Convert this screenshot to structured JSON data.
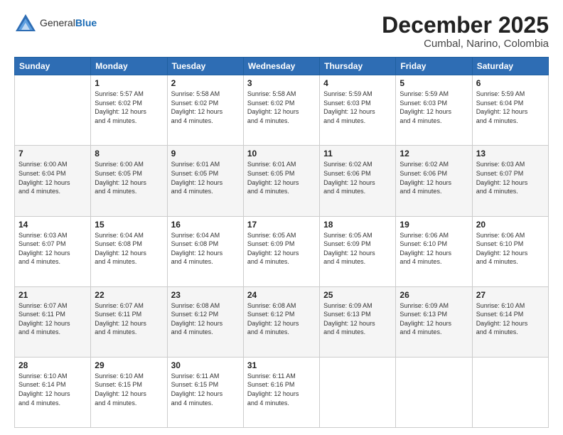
{
  "header": {
    "logo_general": "General",
    "logo_blue": "Blue",
    "month": "December 2025",
    "location": "Cumbal, Narino, Colombia"
  },
  "days_of_week": [
    "Sunday",
    "Monday",
    "Tuesday",
    "Wednesday",
    "Thursday",
    "Friday",
    "Saturday"
  ],
  "weeks": [
    [
      {
        "day": "",
        "info": ""
      },
      {
        "day": "1",
        "info": "Sunrise: 5:57 AM\nSunset: 6:02 PM\nDaylight: 12 hours\nand 4 minutes."
      },
      {
        "day": "2",
        "info": "Sunrise: 5:58 AM\nSunset: 6:02 PM\nDaylight: 12 hours\nand 4 minutes."
      },
      {
        "day": "3",
        "info": "Sunrise: 5:58 AM\nSunset: 6:02 PM\nDaylight: 12 hours\nand 4 minutes."
      },
      {
        "day": "4",
        "info": "Sunrise: 5:59 AM\nSunset: 6:03 PM\nDaylight: 12 hours\nand 4 minutes."
      },
      {
        "day": "5",
        "info": "Sunrise: 5:59 AM\nSunset: 6:03 PM\nDaylight: 12 hours\nand 4 minutes."
      },
      {
        "day": "6",
        "info": "Sunrise: 5:59 AM\nSunset: 6:04 PM\nDaylight: 12 hours\nand 4 minutes."
      }
    ],
    [
      {
        "day": "7",
        "info": "Sunrise: 6:00 AM\nSunset: 6:04 PM\nDaylight: 12 hours\nand 4 minutes."
      },
      {
        "day": "8",
        "info": "Sunrise: 6:00 AM\nSunset: 6:05 PM\nDaylight: 12 hours\nand 4 minutes."
      },
      {
        "day": "9",
        "info": "Sunrise: 6:01 AM\nSunset: 6:05 PM\nDaylight: 12 hours\nand 4 minutes."
      },
      {
        "day": "10",
        "info": "Sunrise: 6:01 AM\nSunset: 6:05 PM\nDaylight: 12 hours\nand 4 minutes."
      },
      {
        "day": "11",
        "info": "Sunrise: 6:02 AM\nSunset: 6:06 PM\nDaylight: 12 hours\nand 4 minutes."
      },
      {
        "day": "12",
        "info": "Sunrise: 6:02 AM\nSunset: 6:06 PM\nDaylight: 12 hours\nand 4 minutes."
      },
      {
        "day": "13",
        "info": "Sunrise: 6:03 AM\nSunset: 6:07 PM\nDaylight: 12 hours\nand 4 minutes."
      }
    ],
    [
      {
        "day": "14",
        "info": "Sunrise: 6:03 AM\nSunset: 6:07 PM\nDaylight: 12 hours\nand 4 minutes."
      },
      {
        "day": "15",
        "info": "Sunrise: 6:04 AM\nSunset: 6:08 PM\nDaylight: 12 hours\nand 4 minutes."
      },
      {
        "day": "16",
        "info": "Sunrise: 6:04 AM\nSunset: 6:08 PM\nDaylight: 12 hours\nand 4 minutes."
      },
      {
        "day": "17",
        "info": "Sunrise: 6:05 AM\nSunset: 6:09 PM\nDaylight: 12 hours\nand 4 minutes."
      },
      {
        "day": "18",
        "info": "Sunrise: 6:05 AM\nSunset: 6:09 PM\nDaylight: 12 hours\nand 4 minutes."
      },
      {
        "day": "19",
        "info": "Sunrise: 6:06 AM\nSunset: 6:10 PM\nDaylight: 12 hours\nand 4 minutes."
      },
      {
        "day": "20",
        "info": "Sunrise: 6:06 AM\nSunset: 6:10 PM\nDaylight: 12 hours\nand 4 minutes."
      }
    ],
    [
      {
        "day": "21",
        "info": "Sunrise: 6:07 AM\nSunset: 6:11 PM\nDaylight: 12 hours\nand 4 minutes."
      },
      {
        "day": "22",
        "info": "Sunrise: 6:07 AM\nSunset: 6:11 PM\nDaylight: 12 hours\nand 4 minutes."
      },
      {
        "day": "23",
        "info": "Sunrise: 6:08 AM\nSunset: 6:12 PM\nDaylight: 12 hours\nand 4 minutes."
      },
      {
        "day": "24",
        "info": "Sunrise: 6:08 AM\nSunset: 6:12 PM\nDaylight: 12 hours\nand 4 minutes."
      },
      {
        "day": "25",
        "info": "Sunrise: 6:09 AM\nSunset: 6:13 PM\nDaylight: 12 hours\nand 4 minutes."
      },
      {
        "day": "26",
        "info": "Sunrise: 6:09 AM\nSunset: 6:13 PM\nDaylight: 12 hours\nand 4 minutes."
      },
      {
        "day": "27",
        "info": "Sunrise: 6:10 AM\nSunset: 6:14 PM\nDaylight: 12 hours\nand 4 minutes."
      }
    ],
    [
      {
        "day": "28",
        "info": "Sunrise: 6:10 AM\nSunset: 6:14 PM\nDaylight: 12 hours\nand 4 minutes."
      },
      {
        "day": "29",
        "info": "Sunrise: 6:10 AM\nSunset: 6:15 PM\nDaylight: 12 hours\nand 4 minutes."
      },
      {
        "day": "30",
        "info": "Sunrise: 6:11 AM\nSunset: 6:15 PM\nDaylight: 12 hours\nand 4 minutes."
      },
      {
        "day": "31",
        "info": "Sunrise: 6:11 AM\nSunset: 6:16 PM\nDaylight: 12 hours\nand 4 minutes."
      },
      {
        "day": "",
        "info": ""
      },
      {
        "day": "",
        "info": ""
      },
      {
        "day": "",
        "info": ""
      }
    ]
  ]
}
